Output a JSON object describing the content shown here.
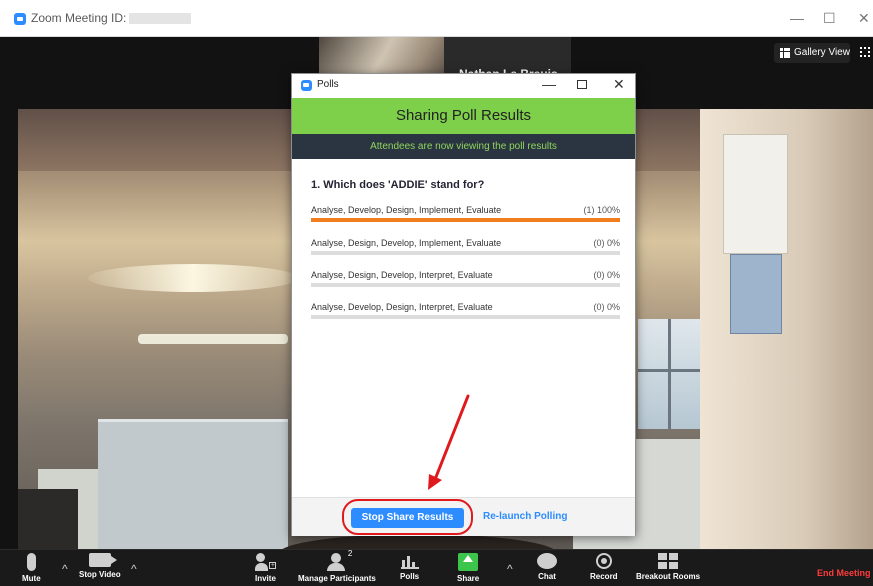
{
  "window": {
    "title": "Zoom Meeting ID:",
    "controls": {
      "minimize": "—",
      "maximize": "☐",
      "close": "✕"
    }
  },
  "video": {
    "top_participant_name": "Nathan Le Breuis",
    "gallery_view_label": "Gallery View"
  },
  "polls_dialog": {
    "title": "Polls",
    "controls": {
      "minimize": "—",
      "close": "✕"
    },
    "header": "Sharing Poll Results",
    "notice": "Attendees are now viewing the poll results",
    "question": "1. Which does 'ADDIE' stand for?",
    "options": [
      {
        "label": "Analyse, Develop, Design, Implement, Evaluate",
        "count": "(1) 100%",
        "percent": 100
      },
      {
        "label": "Analyse, Design, Develop, Implement, Evaluate",
        "count": "(0) 0%",
        "percent": 0
      },
      {
        "label": "Analyse, Design, Develop, Interpret, Evaluate",
        "count": "(0) 0%",
        "percent": 0
      },
      {
        "label": "Analyse, Develop, Design, Interpret, Evaluate",
        "count": "(0) 0%",
        "percent": 0
      }
    ],
    "stop_button": "Stop Share Results",
    "relaunch_button": "Re-launch Polling"
  },
  "toolbar": {
    "mute": "Mute",
    "stop_video": "Stop Video",
    "invite": "Invite",
    "manage_participants": "Manage Participants",
    "participant_count": "2",
    "polls": "Polls",
    "share": "Share",
    "chat": "Chat",
    "record": "Record",
    "breakout_rooms": "Breakout Rooms",
    "end_meeting": "End Meeting",
    "caret": "^"
  },
  "colors": {
    "accent_blue": "#2d8cff",
    "poll_header_green": "#7ed04a",
    "poll_bar_orange": "#f07e1f",
    "highlight_red": "#e0191d",
    "end_meeting_red": "#ff3b3b"
  }
}
